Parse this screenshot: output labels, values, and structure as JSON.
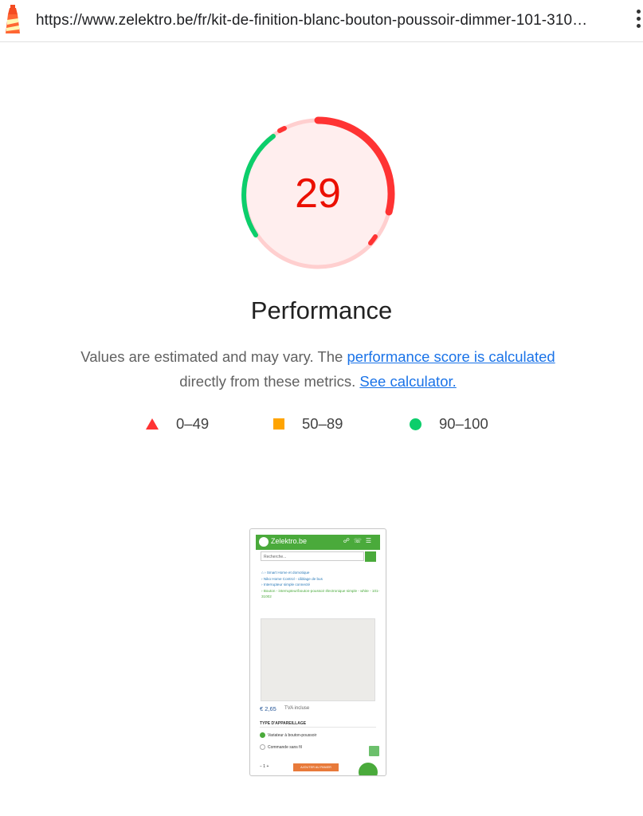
{
  "address_bar": {
    "url": "https://www.zelektro.be/fr/kit-de-finition-blanc-bouton-poussoir-dimmer-101-310…",
    "favicon": "lighthouse-icon",
    "menu_icon": "kebab-menu-icon"
  },
  "performance": {
    "score": "29",
    "score_fraction": 0.29,
    "category_title": "Performance",
    "description_prefix": "Values are estimated and may vary. The ",
    "score_link_text": "performance score is calculated",
    "description_middle": " directly from these metrics. ",
    "calculator_link_text": "See calculator.",
    "colors": {
      "fail": "#ff3333",
      "fail_text": "#eb0f00",
      "average": "#ffa400",
      "pass": "#0cce6b",
      "fail_bg": "#ffeeee"
    }
  },
  "legend": [
    {
      "icon": "red-triangle-icon",
      "label": "0–49"
    },
    {
      "icon": "orange-square-icon",
      "label": "50–89"
    },
    {
      "icon": "green-circle-icon",
      "label": "90–100"
    }
  ],
  "screenshot": {
    "site_name": "Zelektro.be",
    "search_placeholder": "Recherche...",
    "breadcrumbs": [
      "Smart Home et domotique",
      "Niko Home Control - câblage de bus",
      "Interrupteur simple connecté"
    ],
    "breadcrumb_last": "Bouton - interrupteur/bouton-poussoir électronique simple - white - 101-31002",
    "price": "€ 2,65",
    "tax_note": "TVA incluse",
    "type_heading": "TYPE D'APPAREILLAGE",
    "option_1": "Variateur à bouton-poussoir",
    "option_2": "Commande sans fil",
    "quantity": "−  1  +",
    "add_to_cart": "AJOUTER AU PANIER"
  }
}
